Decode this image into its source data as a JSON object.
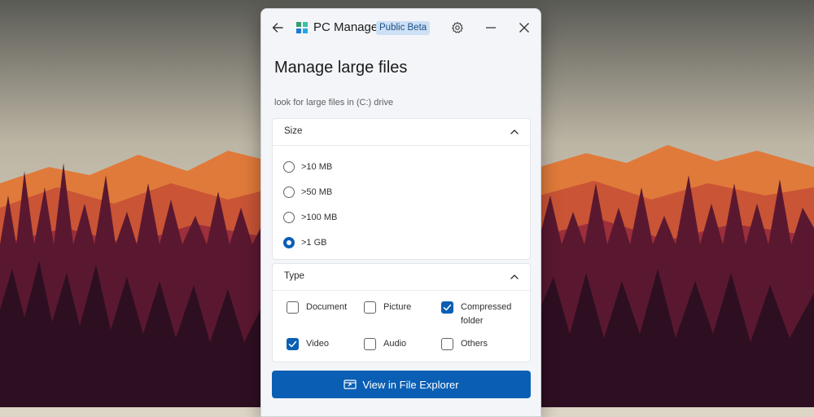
{
  "colors": {
    "accent": "#0a5fb4",
    "badge_bg": "#cde0f4",
    "badge_text": "#1c4f87",
    "window_bg": "#f3f5f9"
  },
  "titlebar": {
    "app_name": "PC Manager",
    "badge": "Public Beta",
    "icons": [
      "back-arrow-icon",
      "app-logo-icon",
      "gear-icon",
      "minimize-icon",
      "close-icon"
    ]
  },
  "page": {
    "title": "Manage large files",
    "subtitle": "look for large files in (C:) drive"
  },
  "size_section": {
    "title": "Size",
    "selected": ">1 GB",
    "options": [
      {
        "label": ">10 MB",
        "selected": false
      },
      {
        "label": ">50 MB",
        "selected": false
      },
      {
        "label": ">100 MB",
        "selected": false
      },
      {
        "label": ">1 GB",
        "selected": true
      }
    ]
  },
  "type_section": {
    "title": "Type",
    "options": [
      {
        "label": "Document",
        "checked": false
      },
      {
        "label": "Picture",
        "checked": false
      },
      {
        "label": "Compressed folder",
        "checked": true
      },
      {
        "label": "Video",
        "checked": true
      },
      {
        "label": "Audio",
        "checked": false
      },
      {
        "label": "Others",
        "checked": false
      }
    ]
  },
  "action": {
    "label": "View in File Explorer",
    "icon": "file-explorer-icon"
  }
}
